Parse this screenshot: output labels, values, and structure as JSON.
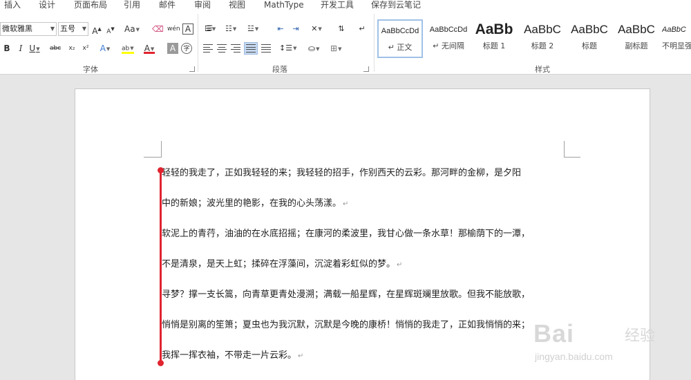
{
  "menu_tabs": [
    "插入",
    "设计",
    "页面布局",
    "引用",
    "邮件",
    "审阅",
    "视图",
    "MathType",
    "开发工具",
    "保存到云笔记"
  ],
  "font_group": {
    "font_name": "微软雅黑",
    "font_size": "五号",
    "grow_label": "A",
    "shrink_label": "A",
    "case_label": "Aa",
    "phonetic_label": "wén",
    "border_char_label": "A",
    "bold_label": "B",
    "italic_label": "I",
    "underline_label": "U",
    "strike_label": "abc",
    "subscript_label": "x₂",
    "superscript_label": "x²",
    "effects_label": "A",
    "highlight_label": "ab",
    "color_label": "A",
    "shading_label": "A",
    "enclose_label": "字",
    "label": "字体"
  },
  "paragraph_group": {
    "label": "段落"
  },
  "styles_group": {
    "label": "样式",
    "items": [
      {
        "sample": "AaBbCcDd",
        "name": "↵ 正文"
      },
      {
        "sample": "AaBbCcDd",
        "name": "↵ 无间隔"
      },
      {
        "sample": "AaBb",
        "name": "标题 1"
      },
      {
        "sample": "AaBbC",
        "name": "标题 2"
      },
      {
        "sample": "AaBbC",
        "name": "标题"
      },
      {
        "sample": "AaBbC",
        "name": "副标题"
      },
      {
        "sample": "AaBbC",
        "name": "不明显强"
      }
    ]
  },
  "document": {
    "lines": [
      "轻轻的我走了，正如我轻轻的来；我轻轻的招手，作别西天的云彩。那河畔的金柳，是夕阳",
      "中的新娘；波光里的艳影，在我的心头荡漾。",
      "软泥上的青荇，油油的在水底招摇；在康河的柔波里，我甘心做一条水草！那榆荫下的一潭，",
      "不是清泉，是天上虹；揉碎在浮藻间，沉淀着彩虹似的梦。",
      "寻梦？撑一支长篙，向青草更青处漫溯；满载一船星辉，在星辉斑斓里放歌。但我不能放歌，",
      "悄悄是别离的笙箫；夏虫也为我沉默，沉默是今晚的康桥！悄悄的我走了，正如我悄悄的来；",
      "我挥一挥衣袖，不带走一片云彩。"
    ],
    "paragraph_mark": "↵"
  },
  "watermark": {
    "brand": "Bai",
    "brand_cn": "经验",
    "url": "jingyan.baidu.com"
  },
  "colors": {
    "accent_red": "#e0242f",
    "style_selected_border": "#9fc1e8",
    "highlight_yellow": "#ffff00",
    "font_color_red": "#e0242f"
  }
}
